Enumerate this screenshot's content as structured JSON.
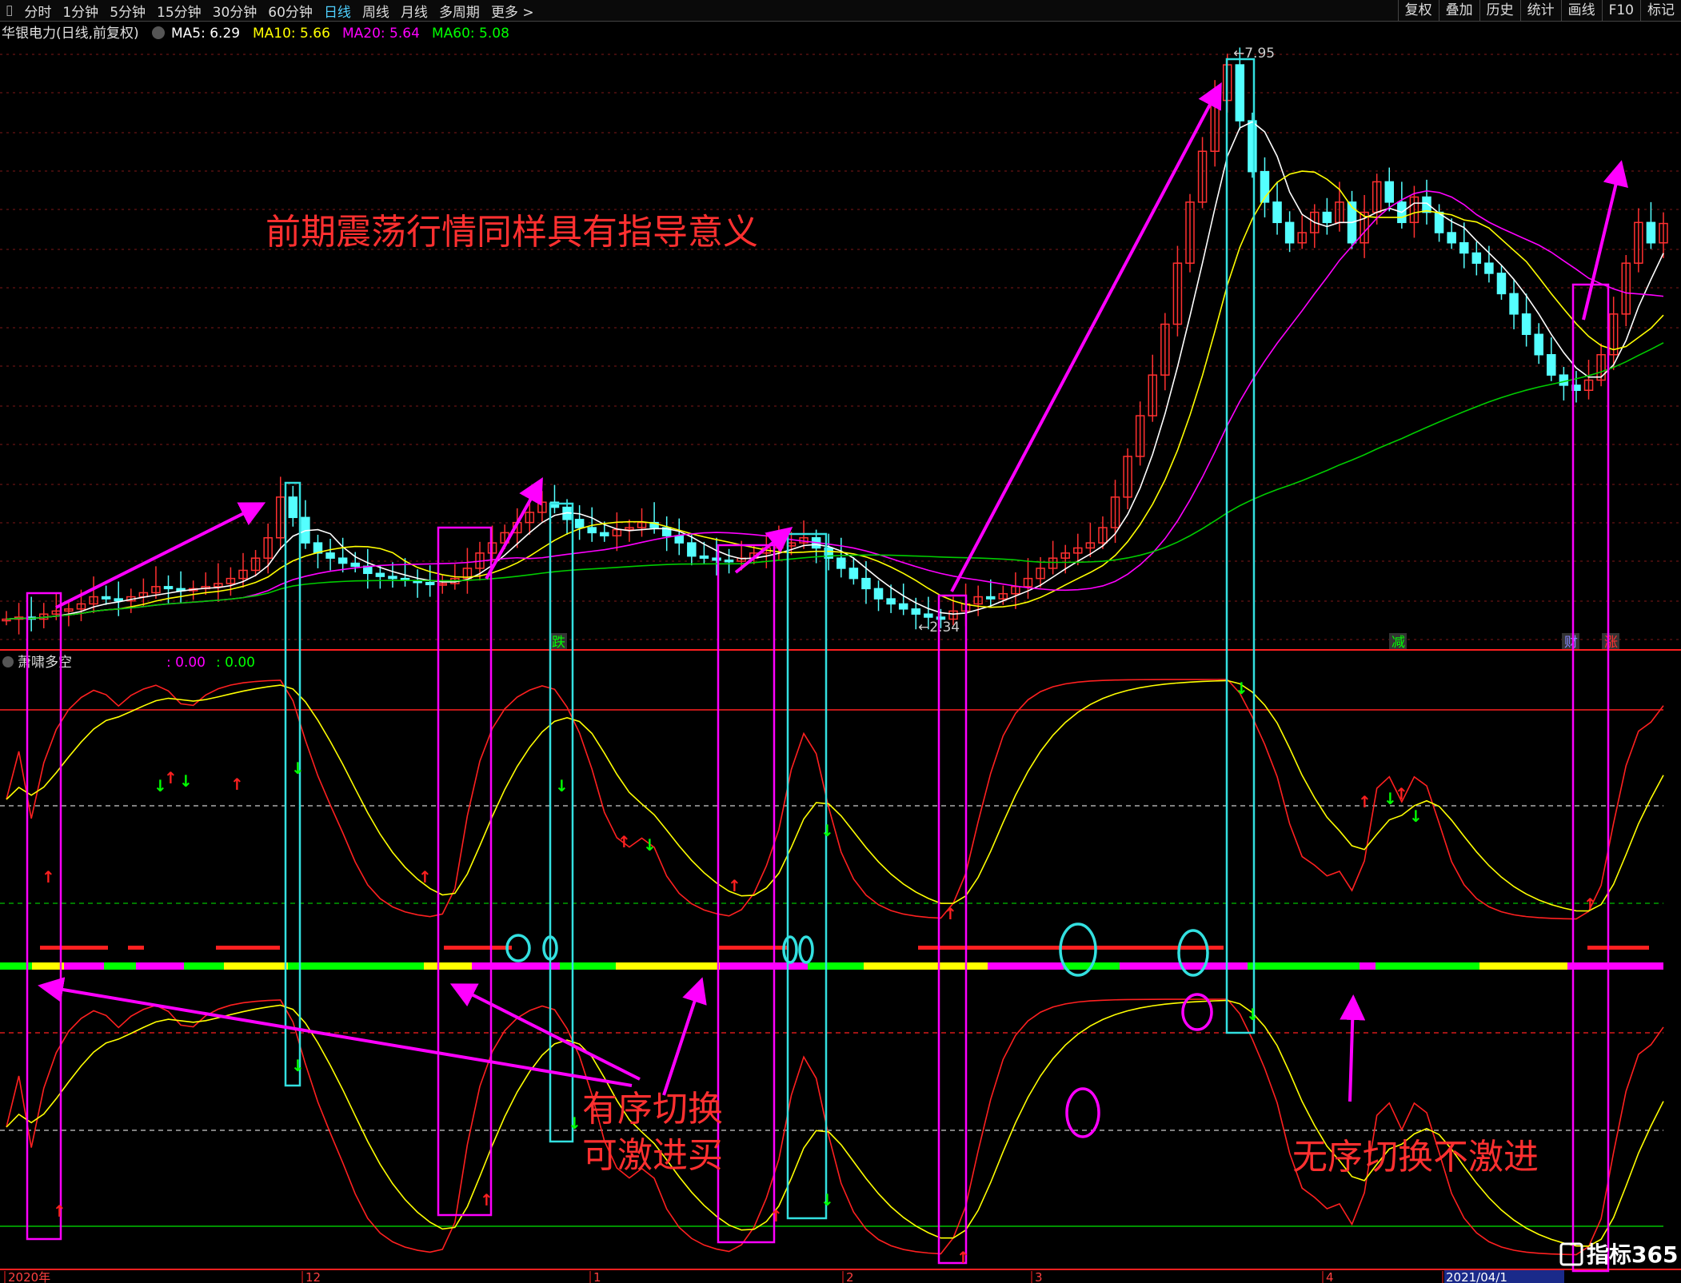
{
  "toolbar": {
    "left": [
      "分时",
      "1分钟",
      "5分钟",
      "15分钟",
      "30分钟",
      "60分钟",
      "日线",
      "周线",
      "月线",
      "多周期",
      "更多 >"
    ],
    "active_index": 6,
    "right": [
      "复权",
      "叠加",
      "历史",
      "统计",
      "画线",
      "F10",
      "标记"
    ]
  },
  "header": {
    "stock": "华银电力(日线,前复权)",
    "ma": [
      {
        "label": "MA5: 6.29",
        "color": "#ffffff"
      },
      {
        "label": "MA10: 5.66",
        "color": "#ffff00"
      },
      {
        "label": "MA20: 5.64",
        "color": "#ff00ff"
      },
      {
        "label": "MA60: 5.08",
        "color": "#00ff00"
      }
    ]
  },
  "indicator": {
    "name": "萧啸多空",
    "v1": ": 0.00",
    "v2": ": 0.00"
  },
  "annotations": {
    "top_text": "前期震荡行情同样具有指导意义",
    "ordered_1": "有序切换",
    "ordered_2": "可激进买",
    "disordered": "无序切换不激进",
    "price_high": "7.95",
    "price_low": "2.34",
    "tag_die": "跌",
    "tag_jian": "减",
    "tag_cai": "财",
    "tag_zhang": "涨"
  },
  "xaxis": {
    "labels": [
      "2020年",
      "12",
      "1",
      "2",
      "3",
      "4",
      "2021/04/1"
    ]
  },
  "watermark": "指标365",
  "colors": {
    "up": "#ff3030",
    "down": "#54ffff",
    "ma5": "#ffffff",
    "ma10": "#ffff00",
    "ma20": "#ff00ff",
    "ma60": "#00cc00",
    "annot": "#ff00ff",
    "box_cyan": "#33e0e0",
    "text_red": "#ff3030"
  },
  "chart_data": {
    "type": "candlestick",
    "price_range": [
      2.2,
      8.0
    ],
    "closes": [
      2.4,
      2.42,
      2.4,
      2.45,
      2.48,
      2.5,
      2.55,
      2.62,
      2.6,
      2.58,
      2.62,
      2.66,
      2.72,
      2.7,
      2.68,
      2.7,
      2.72,
      2.75,
      2.8,
      2.88,
      3.0,
      3.2,
      3.6,
      3.4,
      3.15,
      3.05,
      3.0,
      2.95,
      2.92,
      2.85,
      2.82,
      2.8,
      2.78,
      2.76,
      2.74,
      2.75,
      2.8,
      2.9,
      3.05,
      3.15,
      3.25,
      3.35,
      3.45,
      3.55,
      3.5,
      3.38,
      3.3,
      3.25,
      3.22,
      3.28,
      3.3,
      3.35,
      3.3,
      3.22,
      3.15,
      3.02,
      3.0,
      2.98,
      2.97,
      3.0,
      3.05,
      3.1,
      3.12,
      3.15,
      3.2,
      3.1,
      3.0,
      2.9,
      2.8,
      2.7,
      2.6,
      2.55,
      2.5,
      2.45,
      2.42,
      2.4,
      2.48,
      2.55,
      2.62,
      2.6,
      2.65,
      2.72,
      2.8,
      2.9,
      3.0,
      3.05,
      3.1,
      3.15,
      3.3,
      3.6,
      4.0,
      4.4,
      4.8,
      5.3,
      5.9,
      6.5,
      7.0,
      7.5,
      7.85,
      7.3,
      6.8,
      6.5,
      6.3,
      6.1,
      6.2,
      6.4,
      6.3,
      6.5,
      6.1,
      6.4,
      6.7,
      6.5,
      6.3,
      6.55,
      6.4,
      6.2,
      6.1,
      6.0,
      5.9,
      5.8,
      5.6,
      5.4,
      5.2,
      5.0,
      4.8,
      4.7,
      4.65,
      4.75,
      5.0,
      5.4,
      5.9,
      6.3,
      6.1,
      6.29
    ],
    "oscillator_range": [
      0,
      100
    ]
  }
}
